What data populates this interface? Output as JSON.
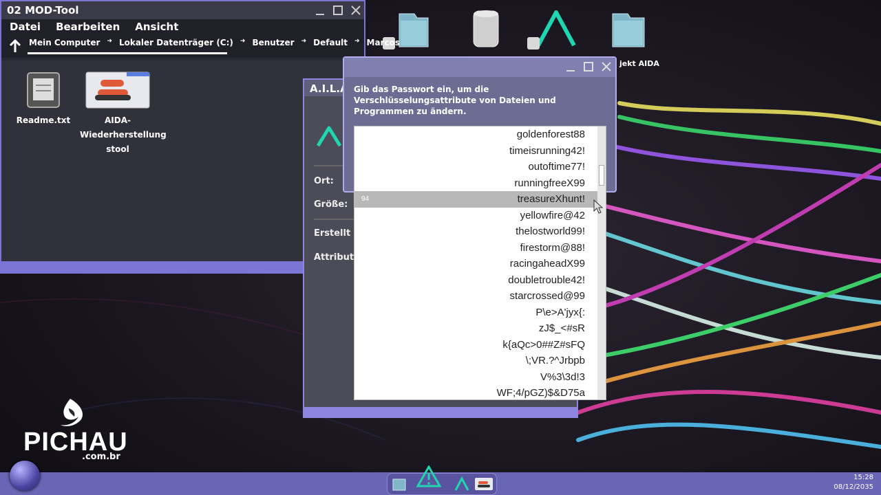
{
  "colors": {
    "accent": "#7b76d6",
    "teal": "#1fd6b0",
    "taskbar": "#6a66b6",
    "selected_row": "#b8b8b8"
  },
  "desktop": {
    "icons": [
      {
        "name": "folder-shortcut-1",
        "icon": "folder-icon"
      },
      {
        "name": "trash",
        "icon": "trash-icon"
      },
      {
        "name": "aila-shortcut",
        "icon": "aila-logo-icon"
      },
      {
        "name": "folder-projekt-aida",
        "icon": "folder-icon"
      }
    ],
    "label_partial": "jekt AIDA"
  },
  "main_window": {
    "title": "02 MOD-Tool",
    "menu": [
      "Datei",
      "Bearbeiten",
      "Ansicht"
    ],
    "breadcrumb": [
      "Mein Computer",
      "Lokaler Datenträger (C:)",
      "Benutzer",
      "Default",
      "Marcos"
    ],
    "files": [
      {
        "label": "Readme.txt",
        "icon": "text-file-icon"
      },
      {
        "label": "AIDA-Wiederherstellungstool",
        "line1": "AIDA-",
        "line2": "Wiederherstellung",
        "line3": "stool",
        "icon": "app-window-icon"
      }
    ]
  },
  "aila_window": {
    "title": "A.I.L.A",
    "labels": {
      "ort": "Ort:",
      "groesse": "Größe:",
      "erstellt": "Erstellt in",
      "attribute": "Attribute:"
    }
  },
  "password_dialog": {
    "message": "Gib das Passwort ein, um die Verschlüsselungsattribute von Dateien und Programmen zu ändern.",
    "selected_index_label": "94",
    "options": [
      "goldenforest88",
      "timeisrunning42!",
      "outoftime77!",
      "runningfreeX99",
      "treasureXhunt!",
      "yellowfire@42",
      "thelostworld99!",
      "firestorm@88!",
      "racingaheadX99",
      "doubletrouble42!",
      "starcrossed@99",
      "P\\e>A'jyx{:",
      "zJ$_<#sR",
      "k{aQc>0##Z#sFQ",
      "\\;VR.?^Jrbpb",
      "V%3\\3d!3",
      "WF;4/pGZ)$&D75a"
    ],
    "selected": "treasureXhunt!"
  },
  "brand": {
    "name": "PICHAU",
    "domain": ".com.br"
  },
  "taskbar": {
    "time": "15:28",
    "date": "08/12/2035"
  }
}
